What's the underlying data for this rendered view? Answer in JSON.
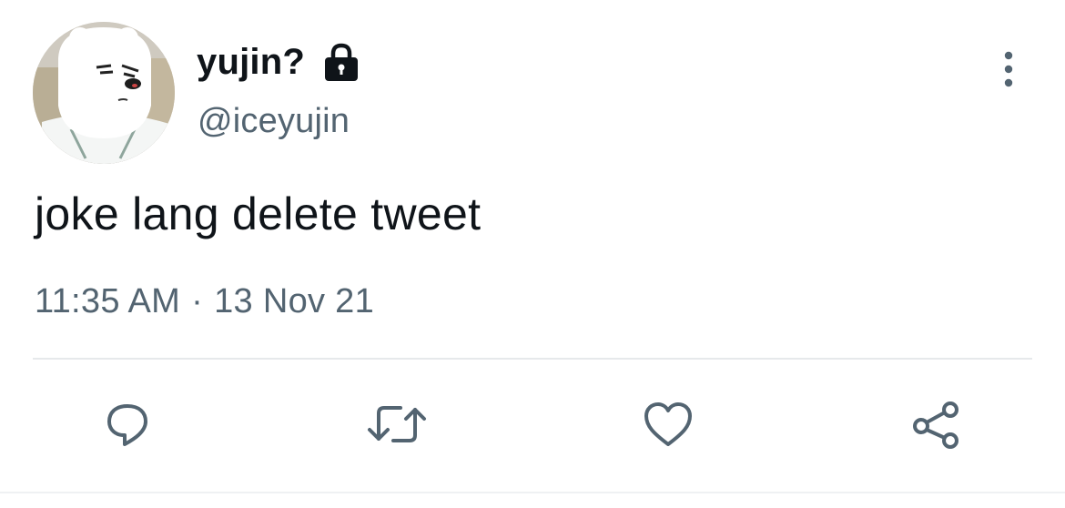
{
  "tweet": {
    "author": {
      "display_name": "yujin?",
      "handle": "@iceyujin",
      "avatar_icon": "polar-bear-avatar",
      "protected_icon": "lock-icon"
    },
    "text": "joke lang delete tweet",
    "time": "11:35 AM",
    "separator": "·",
    "date": "13 Nov 21"
  },
  "actions": {
    "reply_icon": "reply-icon",
    "retweet_icon": "retweet-icon",
    "like_icon": "heart-icon",
    "share_icon": "share-icon"
  },
  "menu": {
    "more_icon": "more-vertical-icon"
  },
  "colors": {
    "text_primary": "#0f1419",
    "text_secondary": "#536471",
    "icon": "#536471",
    "divider": "#e6e9eb"
  }
}
